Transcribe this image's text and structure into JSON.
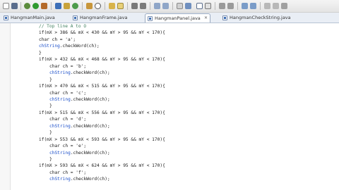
{
  "toolbar": {
    "icons": [
      "new-icon",
      "save-icon",
      "debug-icon",
      "run-icon",
      "external-tools-icon",
      "new-java-project-icon",
      "new-package-icon",
      "new-class-icon",
      "open-type-icon",
      "search-icon",
      "annotation-icon",
      "toggle-mark-occurrences-icon",
      "next-annotation-icon",
      "prev-annotation-icon",
      "back-icon",
      "forward-icon"
    ]
  },
  "tabs": [
    {
      "label": "HangmanMain.java",
      "active": false
    },
    {
      "label": "HangmanFrame.java",
      "active": false
    },
    {
      "label": "HangmanPanel.java",
      "active": true
    },
    {
      "label": "HangmanCheckString.java",
      "active": false
    }
  ],
  "code": {
    "lines": [
      {
        "indent": 8,
        "text": "// Top line A to O",
        "kind": "comment"
      },
      {
        "indent": 8,
        "text": "if(mX > 386 && mX < 430 && mY > 95 && mY < 170){",
        "kind": "code"
      },
      {
        "indent": 8,
        "text": "char ch = 'a';",
        "kind": "code"
      },
      {
        "indent": 8,
        "text": "chString.checkWord(ch);",
        "kind": "call"
      },
      {
        "indent": 8,
        "text": "}",
        "kind": "code"
      },
      {
        "indent": 8,
        "text": "if(mX > 432 && mX < 468 && mY > 95 && mY < 170){",
        "kind": "code"
      },
      {
        "indent": 12,
        "text": "char ch = 'b';",
        "kind": "code"
      },
      {
        "indent": 12,
        "text": "chString.checkWord(ch);",
        "kind": "call"
      },
      {
        "indent": 12,
        "text": "}",
        "kind": "code"
      },
      {
        "indent": 8,
        "text": "if(mX > 470 && mX < 515 && mY > 95 && mY < 170){",
        "kind": "code"
      },
      {
        "indent": 12,
        "text": "char ch = 'c';",
        "kind": "code"
      },
      {
        "indent": 12,
        "text": "chString.checkWord(ch);",
        "kind": "call"
      },
      {
        "indent": 12,
        "text": "}",
        "kind": "code"
      },
      {
        "indent": 8,
        "text": "if(mX > 515 && mX < 556 && mY > 95 && mY < 170){",
        "kind": "code"
      },
      {
        "indent": 12,
        "text": "char ch = 'd';",
        "kind": "code"
      },
      {
        "indent": 12,
        "text": "chString.checkWord(ch);",
        "kind": "call"
      },
      {
        "indent": 12,
        "text": "}",
        "kind": "code"
      },
      {
        "indent": 8,
        "text": "if(mX > 553 && mX < 593 && mY > 95 && mY < 170){",
        "kind": "code"
      },
      {
        "indent": 12,
        "text": "char ch = 'e';",
        "kind": "code"
      },
      {
        "indent": 12,
        "text": "chString.checkWord(ch);",
        "kind": "call"
      },
      {
        "indent": 12,
        "text": "}",
        "kind": "code"
      },
      {
        "indent": 8,
        "text": "if(mX > 593 && mX < 624 && mY > 95 && mY < 170){",
        "kind": "code"
      },
      {
        "indent": 12,
        "text": "char ch = 'f';",
        "kind": "code"
      },
      {
        "indent": 12,
        "text": "chString.checkWord(ch);",
        "kind": "call"
      }
    ]
  }
}
